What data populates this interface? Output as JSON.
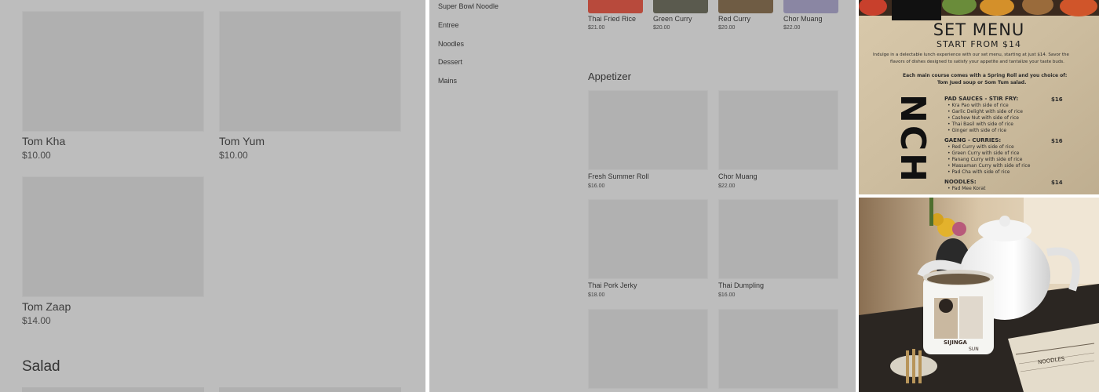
{
  "panel_left": {
    "items": [
      {
        "name": "Tom Kha",
        "price": "$10.00"
      },
      {
        "name": "Tom Yum",
        "price": "$10.00"
      },
      {
        "name": "Tom Zaap",
        "price": "$14.00"
      }
    ],
    "section_heading": "Salad"
  },
  "panel_middle": {
    "categories": [
      "Super Bowl Noodle",
      "Entree",
      "Noodles",
      "Dessert",
      "Mains"
    ],
    "top_items": [
      {
        "name": "Thai Fried Rice",
        "price": "$21.00",
        "color": "#b84a3c"
      },
      {
        "name": "Green Curry",
        "price": "$20.00",
        "color": "#5a5a4e"
      },
      {
        "name": "Red Curry",
        "price": "$20.00",
        "color": "#6f5c44"
      },
      {
        "name": "Chor Muang",
        "price": "$22.00",
        "color": "#8a86a3"
      }
    ],
    "section_heading": "Appetizer",
    "items": [
      {
        "name": "Fresh Summer Roll",
        "price": "$16.00"
      },
      {
        "name": "Chor Muang",
        "price": "$22.00"
      },
      {
        "name": "Thai Pork Jerky",
        "price": "$18.00"
      },
      {
        "name": "Thai Dumpling",
        "price": "$16.00"
      }
    ]
  },
  "set_menu": {
    "title": "SET MENU",
    "subtitle": "START FROM $14",
    "intro_1": "Indulge in a delectable lunch experience with our set menu, starting at just $14. Savor the",
    "intro_2": "flavors of dishes designed to satisfy your appetite and tantalize your taste buds.",
    "note_1": "Each main course comes with a Spring Roll and you choice of:",
    "note_2": "Tom Jued soup or Som Tum salad.",
    "side_word": "NCH",
    "sections": [
      {
        "title": "PAD SAUCES - STIR FRY:",
        "price": "$16",
        "lines": [
          "Kra Pao with side of rice",
          "Garlic Delight with side of rice",
          "Cashew Nut with side of rice",
          "Thai Basil with side of rice",
          "Ginger with side of rice"
        ]
      },
      {
        "title": "GAENG - CURRIES:",
        "price": "$16",
        "lines": [
          "Red Curry with side of rice",
          "Green Curry with side of rice",
          "Panang Curry with side of rice",
          "Massaman Curry with side of rice",
          "Pad Cha with side of rice"
        ]
      },
      {
        "title": "NOODLES:",
        "price": "$14",
        "lines": [
          "Pad Mee Korat"
        ]
      }
    ]
  },
  "photo": {
    "mug_text": "SIJINGA",
    "mug_text_2": "SUN",
    "menu_card_text": "NOODLES"
  },
  "colors": {
    "panel_bg": "#bdbdbd",
    "placeholder": "#b0b0b0",
    "paper": "#d4c4a7"
  }
}
